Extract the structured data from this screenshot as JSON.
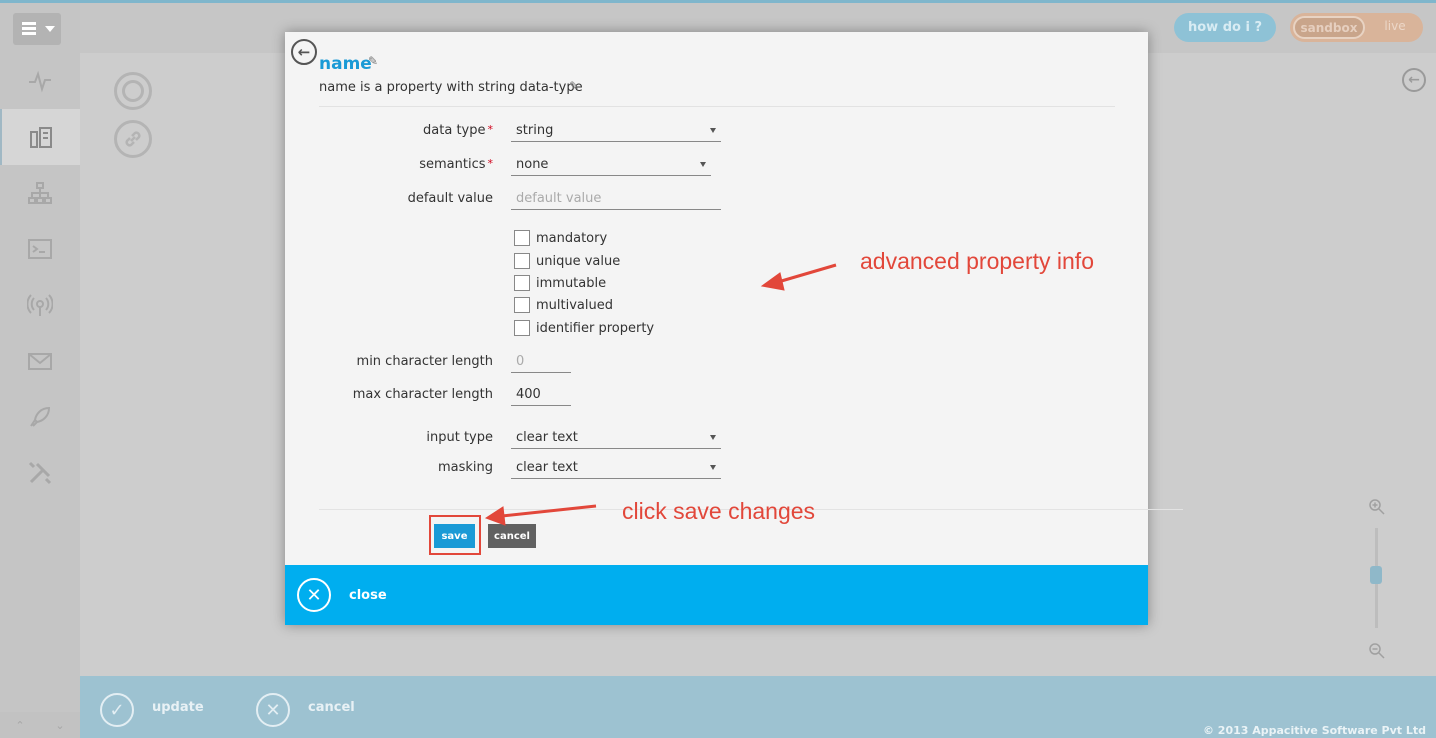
{
  "app": {
    "how_do_i": "how do i ?",
    "env_active": "sandbox",
    "env_inactive": "live",
    "footer_update": "update",
    "footer_cancel": "cancel",
    "copyright": "© 2013 Appacitive Software Pvt Ltd"
  },
  "dialog": {
    "title": "name",
    "subtitle": "name is a property with string data-type",
    "fields": {
      "data_type_label": "data type",
      "data_type_value": "string",
      "semantics_label": "semantics",
      "semantics_value": "none",
      "default_value_label": "default value",
      "default_value_placeholder": "default value",
      "min_length_label": "min character length",
      "min_length_value": "0",
      "max_length_label": "max character length",
      "max_length_value": "400",
      "input_type_label": "input type",
      "input_type_value": "clear text",
      "masking_label": "masking",
      "masking_value": "clear text"
    },
    "required_marker": "*",
    "checkboxes": [
      {
        "label": "mandatory",
        "checked": false
      },
      {
        "label": "unique value",
        "checked": false
      },
      {
        "label": "immutable",
        "checked": false
      },
      {
        "label": "multivalued",
        "checked": false
      },
      {
        "label": "identifier property",
        "checked": false
      }
    ],
    "save_label": "save",
    "cancel_label": "cancel",
    "close_label": "close"
  },
  "annotations": {
    "advanced": "advanced property info",
    "save": "click save changes",
    "color": "#e2473a"
  },
  "colors": {
    "accent": "#00aeef",
    "title": "#1a9ad6"
  }
}
